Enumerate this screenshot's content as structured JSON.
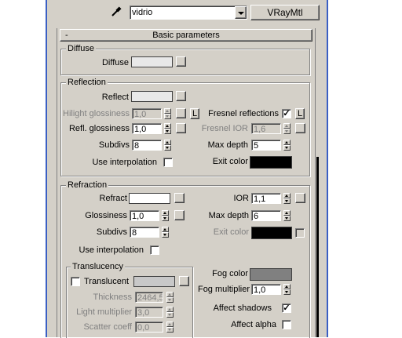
{
  "top": {
    "material_name": "vidrio",
    "material_type": "VRayMtl"
  },
  "rollout": {
    "toggle": "-",
    "title": "Basic parameters"
  },
  "diffuse": {
    "group": "Diffuse",
    "label": "Diffuse",
    "color": "#e8e8e8"
  },
  "reflection": {
    "group": "Reflection",
    "reflect_label": "Reflect",
    "reflect_color": "#e8e8e8",
    "hilight_label": "Hilight glossiness",
    "hilight_value": "1,0",
    "refl_gloss_label": "Refl. glossiness",
    "refl_gloss_value": "1,0",
    "subdivs_label": "Subdivs",
    "subdivs_value": "8",
    "interp_label": "Use interpolation",
    "interp_checked": "",
    "lock_label": "L",
    "fresnel_label": "Fresnel reflections",
    "fresnel_checked": "✓",
    "fresnel_lock": "L",
    "fresnel_ior_label": "Fresnel IOR",
    "fresnel_ior_value": "1,6",
    "max_depth_label": "Max depth",
    "max_depth_value": "5",
    "exit_label": "Exit color",
    "exit_color": "#000000"
  },
  "refraction": {
    "group": "Refraction",
    "refract_label": "Refract",
    "refract_color": "#ffffff",
    "gloss_label": "Glossiness",
    "gloss_value": "1,0",
    "subdivs_label": "Subdivs",
    "subdivs_value": "8",
    "interp_label": "Use interpolation",
    "ior_label": "IOR",
    "ior_value": "1,1",
    "max_depth_label": "Max depth",
    "max_depth_value": "6",
    "exit_label": "Exit color",
    "exit_color": "#000000"
  },
  "translucency": {
    "group": "Translucency",
    "translucent_label": "Translucent",
    "translucent_color": "#c8c8c8",
    "thickness_label": "Thickness",
    "thickness_value": "2464,5",
    "light_mult_label": "Light multiplier",
    "light_mult_value": "3,0",
    "scatter_label": "Scatter coeff",
    "scatter_value": "0,0"
  },
  "fog": {
    "color_label": "Fog color",
    "color": "#808080",
    "mult_label": "Fog multiplier",
    "mult_value": "1,0",
    "shadows_label": "Affect shadows",
    "shadows_checked": "✓",
    "alpha_label": "Affect alpha",
    "alpha_checked": ""
  }
}
